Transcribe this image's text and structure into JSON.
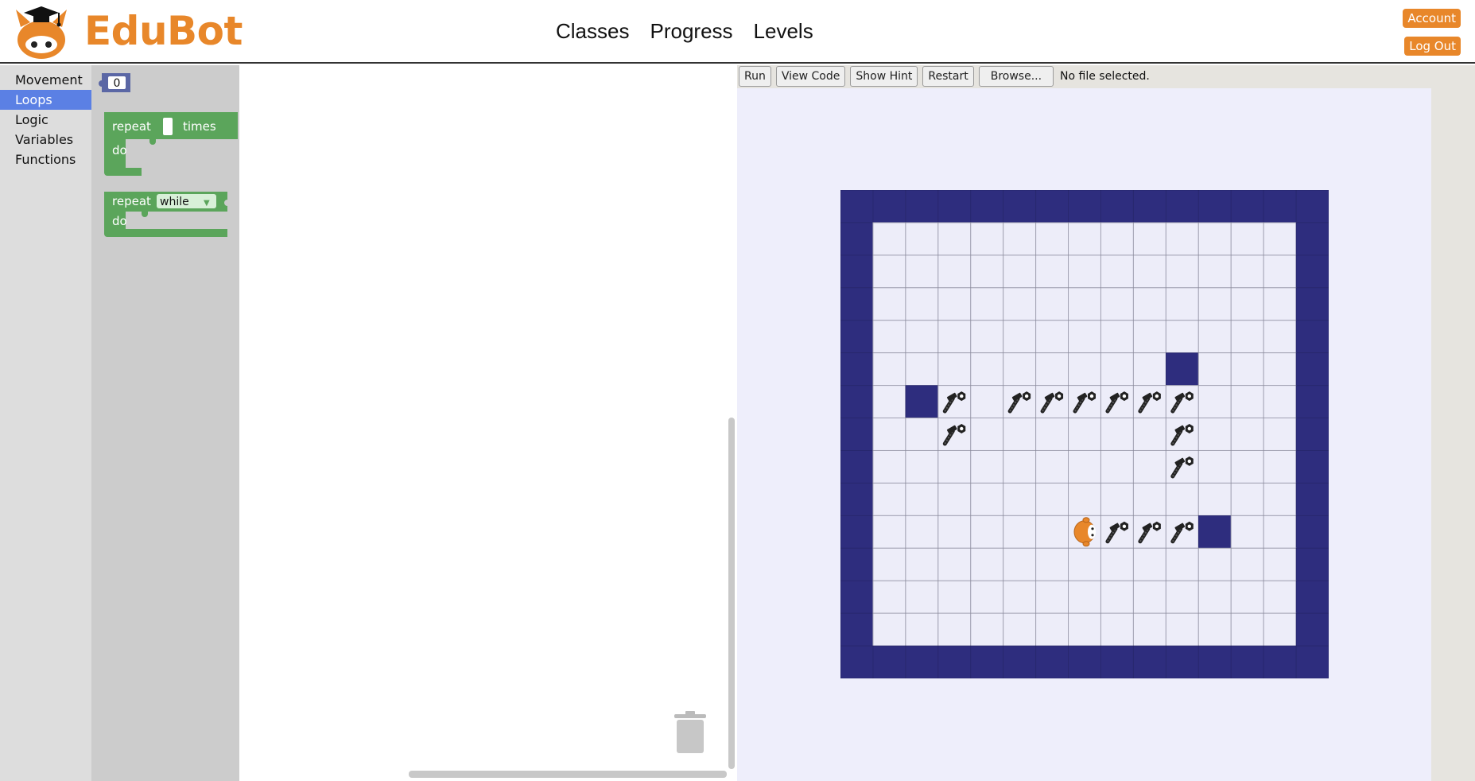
{
  "app": {
    "name": "EduBot"
  },
  "nav": {
    "classes": "Classes",
    "progress": "Progress",
    "levels": "Levels"
  },
  "account": {
    "account_label": "Account",
    "logout_label": "Log Out"
  },
  "toolbox": {
    "categories": [
      {
        "label": "Movement",
        "active": false
      },
      {
        "label": "Loops",
        "active": true
      },
      {
        "label": "Logic",
        "active": false
      },
      {
        "label": "Variables",
        "active": false
      },
      {
        "label": "Functions",
        "active": false
      }
    ]
  },
  "blocks": {
    "number_value": "0",
    "repeat_times": {
      "repeat": "repeat",
      "times": "times",
      "do": "do"
    },
    "repeat_while": {
      "repeat": "repeat",
      "mode": "while",
      "do": "do"
    },
    "color": "#5ba55b"
  },
  "toolbar": {
    "run": "Run",
    "view_code": "View Code",
    "show_hint": "Show Hint",
    "restart": "Restart",
    "browse": "Browse...",
    "file_status": "No file selected."
  },
  "colors": {
    "brand": "#e8872a",
    "wall": "#2e2d7e",
    "floor": "#ededf9",
    "active_category": "#5b80e4"
  },
  "maze": {
    "size": 15,
    "inner_walls": [
      [
        2,
        6
      ],
      [
        10,
        5
      ],
      [
        11,
        10
      ]
    ],
    "bolts": [
      [
        3,
        6
      ],
      [
        5,
        6
      ],
      [
        6,
        6
      ],
      [
        7,
        6
      ],
      [
        8,
        6
      ],
      [
        9,
        6
      ],
      [
        10,
        6
      ],
      [
        3,
        7
      ],
      [
        10,
        7
      ],
      [
        10,
        8
      ],
      [
        8,
        10
      ],
      [
        9,
        10
      ],
      [
        10,
        10
      ]
    ],
    "robot": [
      7,
      10
    ]
  }
}
